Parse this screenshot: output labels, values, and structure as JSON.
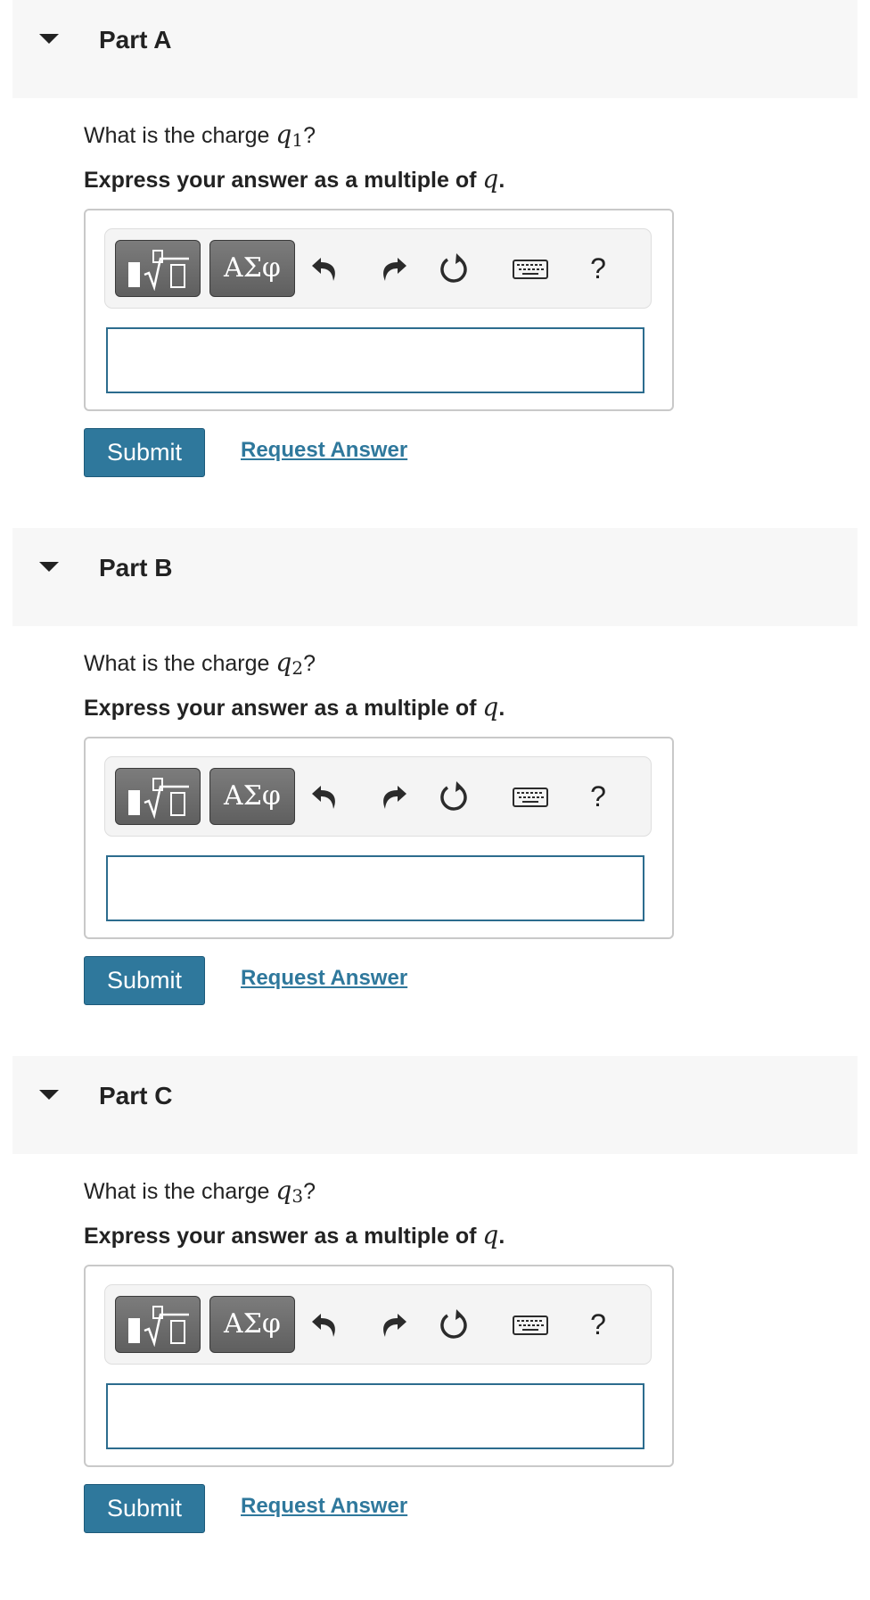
{
  "parts": [
    {
      "title": "Part A",
      "question_prefix": "What is the charge",
      "var": "q",
      "var_sub": "1",
      "question_suffix": "?",
      "express_prefix": "Express your answer as a multiple of",
      "express_var": "q",
      "express_suffix": ".",
      "symbols_label": "ΑΣφ",
      "help_label": "?",
      "input_value": "",
      "submit_label": "Submit",
      "request_label": "Request Answer"
    },
    {
      "title": "Part B",
      "question_prefix": "What is the charge",
      "var": "q",
      "var_sub": "2",
      "question_suffix": "?",
      "express_prefix": "Express your answer as a multiple of",
      "express_var": "q",
      "express_suffix": ".",
      "symbols_label": "ΑΣφ",
      "help_label": "?",
      "input_value": "",
      "submit_label": "Submit",
      "request_label": "Request Answer"
    },
    {
      "title": "Part C",
      "question_prefix": "What is the charge",
      "var": "q",
      "var_sub": "3",
      "question_suffix": "?",
      "express_prefix": "Express your answer as a multiple of",
      "express_var": "q",
      "express_suffix": ".",
      "symbols_label": "ΑΣφ",
      "help_label": "?",
      "input_value": "",
      "submit_label": "Submit",
      "request_label": "Request Answer"
    }
  ],
  "icons": {
    "templates": "math-templates-icon",
    "undo": "undo-icon",
    "redo": "redo-icon",
    "reset": "reset-icon",
    "keyboard": "keyboard-icon",
    "caret": "caret-down-icon"
  },
  "colors": {
    "header_bg": "#f7f7f7",
    "accent": "#2f789c",
    "input_border": "#2c6c8e",
    "toolbar_btn": "#6d6d6d"
  }
}
